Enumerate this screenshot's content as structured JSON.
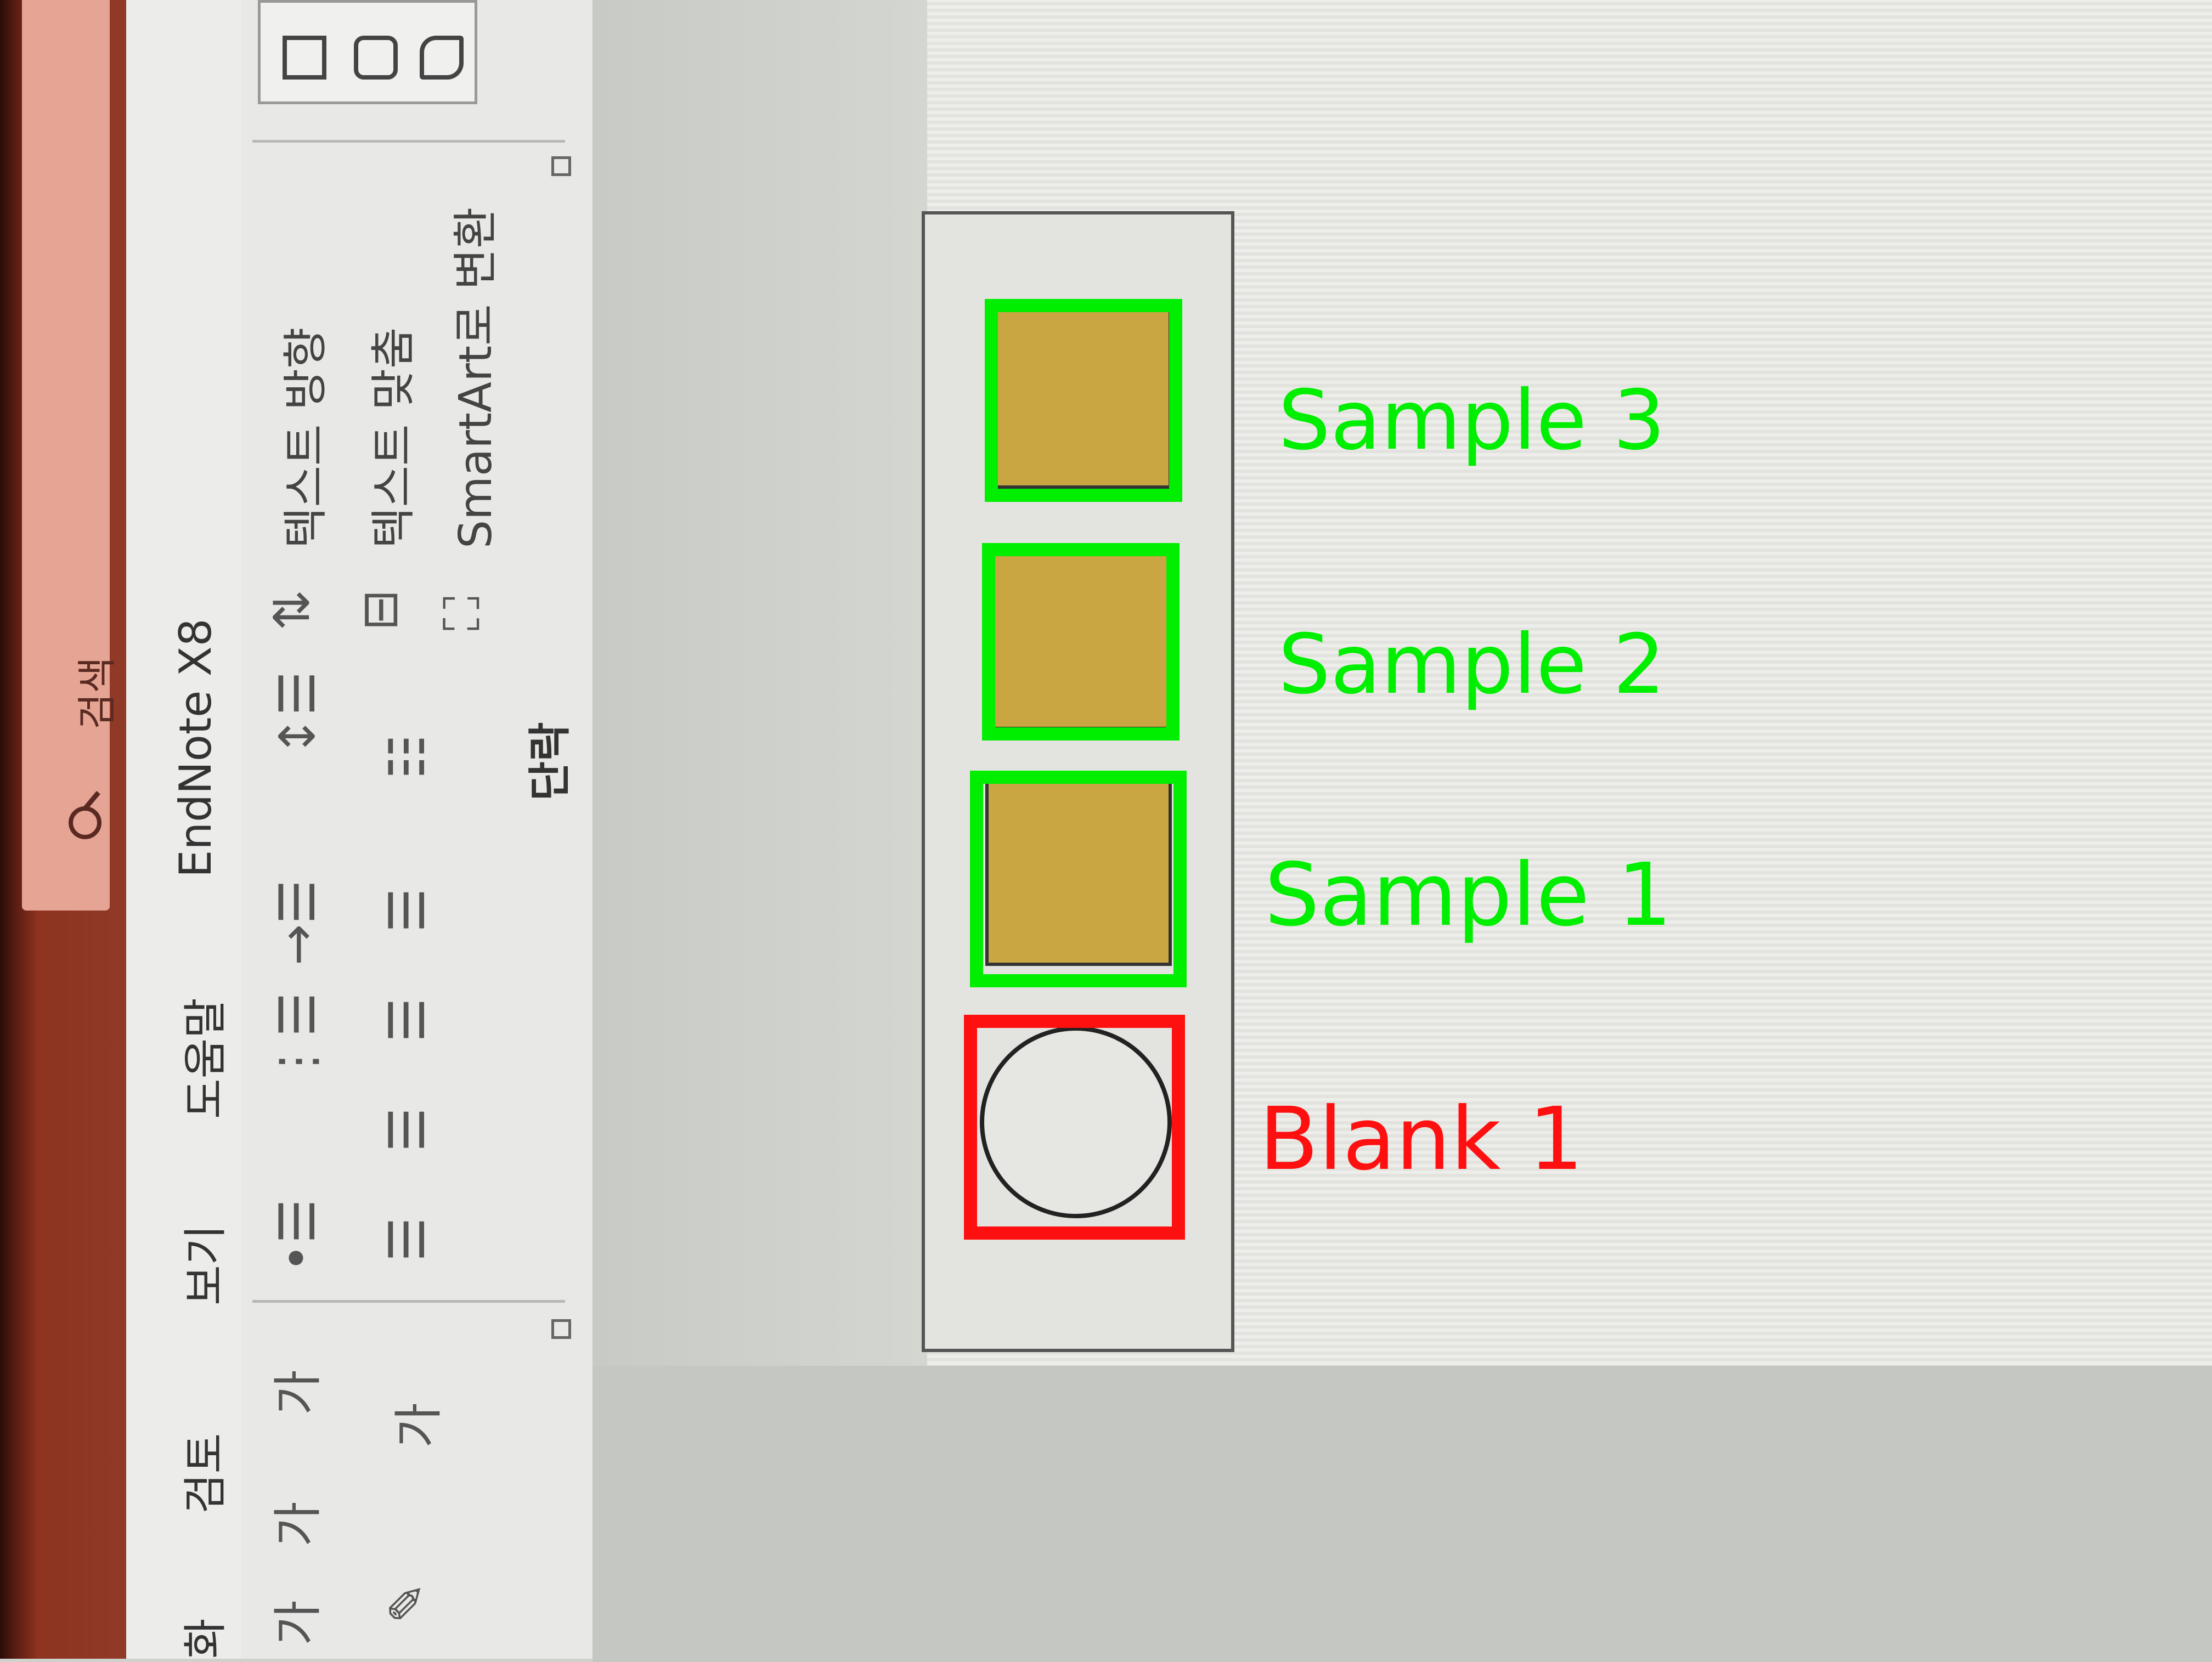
{
  "title_bar": {
    "search_label": "검색"
  },
  "ribbon_tabs": {
    "items": [
      "화",
      "검토",
      "보기",
      "도움말",
      "EndNote X8"
    ]
  },
  "ribbon": {
    "font_group": {
      "grow_font": "가",
      "shrink_font": "가",
      "clear_format": "가",
      "font_color": "가"
    },
    "paragraph_group": {
      "label": "단락",
      "text_direction": "텍스트 방향",
      "align_text": "텍스트 맞춤",
      "smartart": "SmartArt로 변환"
    }
  },
  "annotations": [
    {
      "label": "Sample 3",
      "color": "#00ee00"
    },
    {
      "label": "Sample 2",
      "color": "#00ee00"
    },
    {
      "label": "Sample 1",
      "color": "#00ee00"
    },
    {
      "label": "Blank 1",
      "color": "#ff1010"
    }
  ],
  "colors": {
    "sample_fill": "#c9a642",
    "title_bar": "#8e3320"
  }
}
